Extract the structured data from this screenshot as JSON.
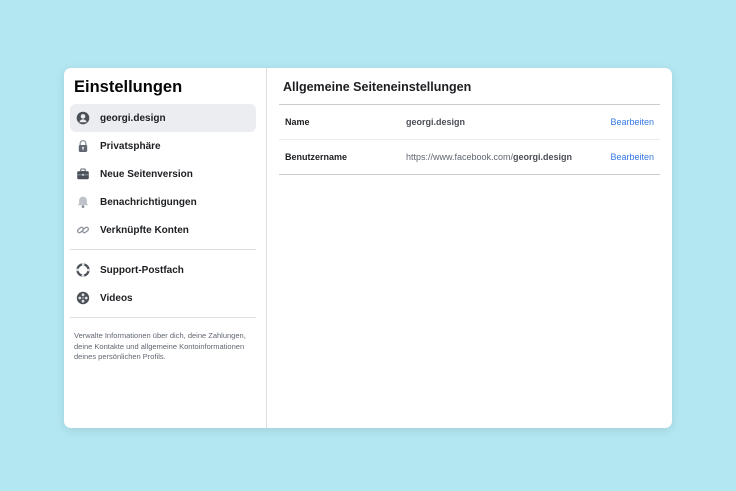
{
  "sidebar": {
    "title": "Einstellungen",
    "items": [
      {
        "label": "georgi.design",
        "icon": "profile-icon",
        "active": true
      },
      {
        "label": "Privatsphäre",
        "icon": "lock-icon",
        "active": false
      },
      {
        "label": "Neue Seitenversion",
        "icon": "briefcase-icon",
        "active": false
      },
      {
        "label": "Benachrichtigungen",
        "icon": "bell-icon",
        "active": false
      },
      {
        "label": "Verknüpfte Konten",
        "icon": "link-icon",
        "active": false
      }
    ],
    "items2": [
      {
        "label": "Support-Postfach",
        "icon": "lifebuoy-icon",
        "active": false
      },
      {
        "label": "Videos",
        "icon": "film-reel-icon",
        "active": false
      }
    ],
    "description": "Verwalte Informationen über dich, deine Zahlungen, deine Kontakte und allgemeine Kontoinformationen deines persönlichen Profils."
  },
  "main": {
    "title": "Allgemeine Seiteneinstellungen",
    "rows": [
      {
        "label": "Name",
        "value_prefix": "",
        "value_bold": "georgi.design",
        "edit": "Bearbeiten"
      },
      {
        "label": "Benutzername",
        "value_prefix": "https://www.facebook.com/",
        "value_bold": "georgi.design",
        "edit": "Bearbeiten"
      }
    ]
  },
  "colors": {
    "background": "#b3e7f2",
    "active_item": "#ebedf0",
    "link": "#3578e5"
  }
}
